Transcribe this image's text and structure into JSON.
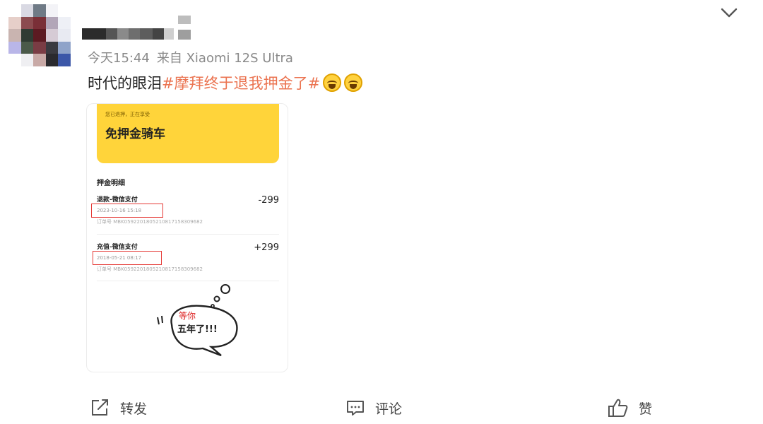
{
  "post": {
    "meta_time": "今天15:44",
    "meta_source": "来自 Xiaomi 12S Ultra",
    "text_plain": "时代的眼泪",
    "text_tag": "#摩拜终于退我押金了#",
    "emoji_count": 2,
    "emoji_icon": "laugh-cry-emoji"
  },
  "screenshot": {
    "banner_subtitle": "您已退押，正在享受",
    "banner_title": "免押金骑车",
    "section_title": "押金明细",
    "records": [
      {
        "label": "退款-微信支付",
        "date": "2023-10-16 15:18",
        "order": "订单号 MBK0592201805210817158309682",
        "amount": "-299"
      },
      {
        "label": "充值-微信支付",
        "date": "2018-05-21 08:17",
        "order": "订单号 MBK0592201805210817158309682",
        "amount": "+299"
      }
    ],
    "bubble_text_line1": "等你",
    "bubble_text_line2": "五年了!!!"
  },
  "actions": {
    "repost": "转发",
    "comment": "评论",
    "like": "赞"
  },
  "colors": {
    "tag": "#eb7350",
    "banner": "#ffd43a",
    "highlight_box": "#e53935"
  }
}
